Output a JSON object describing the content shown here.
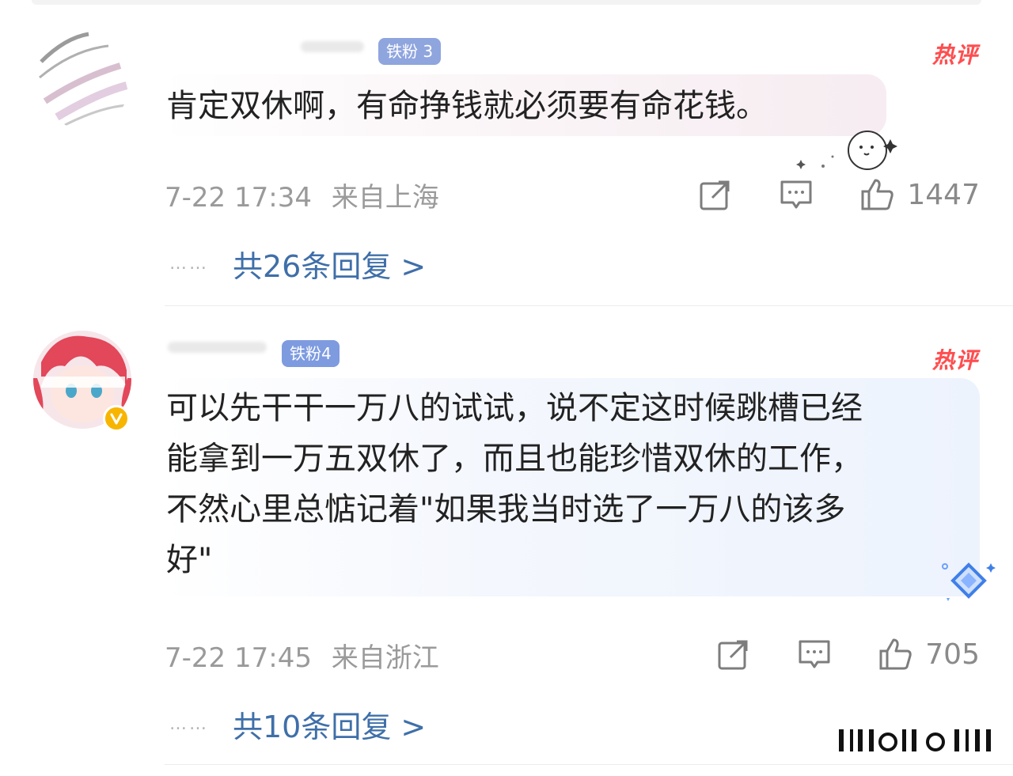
{
  "colors": {
    "hot": "#ff4d4f",
    "reply_link": "#3f6fa9",
    "meta": "#9a9a9a",
    "fan_badge": "#7a95d9"
  },
  "comments": [
    {
      "fan_badge": "铁粉 3",
      "hot_label": "热评",
      "text": "肯定双休啊，有命挣钱就必须要有命花钱。",
      "time": "7-22 17:34",
      "location": "来自上海",
      "likes": "1447",
      "replies_label": "共26条回复 >",
      "dots": "……",
      "icons": [
        "share-icon",
        "comment-icon",
        "like-icon"
      ]
    },
    {
      "fan_badge": "铁粉4",
      "hot_label": "热评",
      "text": "可以先干干一万八的试试，说不定这时候跳槽已经\n能拿到一万五双休了，而且也能珍惜双休的工作，\n不然心里总惦记着\"如果我当时选了一万八的该多\n好\"",
      "time": "7-22 17:45",
      "location": "来自浙江",
      "likes": "705",
      "replies_label": "共10条回复 >",
      "dots": "……",
      "icons": [
        "share-icon",
        "comment-icon",
        "like-icon"
      ]
    }
  ]
}
